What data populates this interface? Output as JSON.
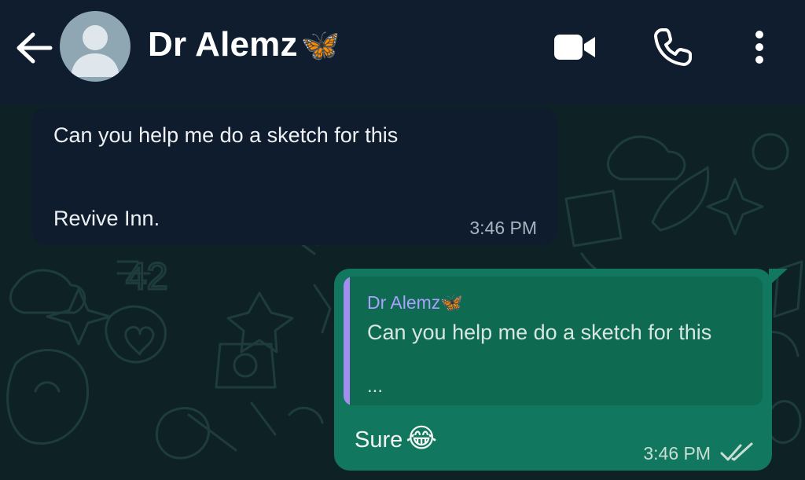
{
  "header": {
    "contact_name": "Dr Alemz",
    "name_emoji": "🦋",
    "icons": {
      "back": "arrow-left-icon",
      "avatar": "default-avatar-icon",
      "video": "video-camera-icon",
      "voice": "phone-icon",
      "menu": "more-vertical-icon"
    }
  },
  "messages": {
    "incoming": {
      "line1": "Can you help me do a sketch for this",
      "line2": "Revive Inn.",
      "time": "3:46 PM"
    },
    "outgoing": {
      "quoted_author": "Dr Alemz",
      "quoted_author_emoji": "🦋",
      "quoted_text": "Can you help me do a sketch for this",
      "quoted_ellipsis": "...",
      "text": "Sure",
      "emoji": "😂",
      "time": "3:46 PM",
      "status_icon": "double-check-read-icon"
    }
  },
  "colors": {
    "header_bg": "#0f1d2f",
    "incoming_bubble": "#0f1c2e",
    "outgoing_bubble": "#12775f",
    "quote_accent": "#a58cf0",
    "quote_author": "#a9a0ff"
  }
}
